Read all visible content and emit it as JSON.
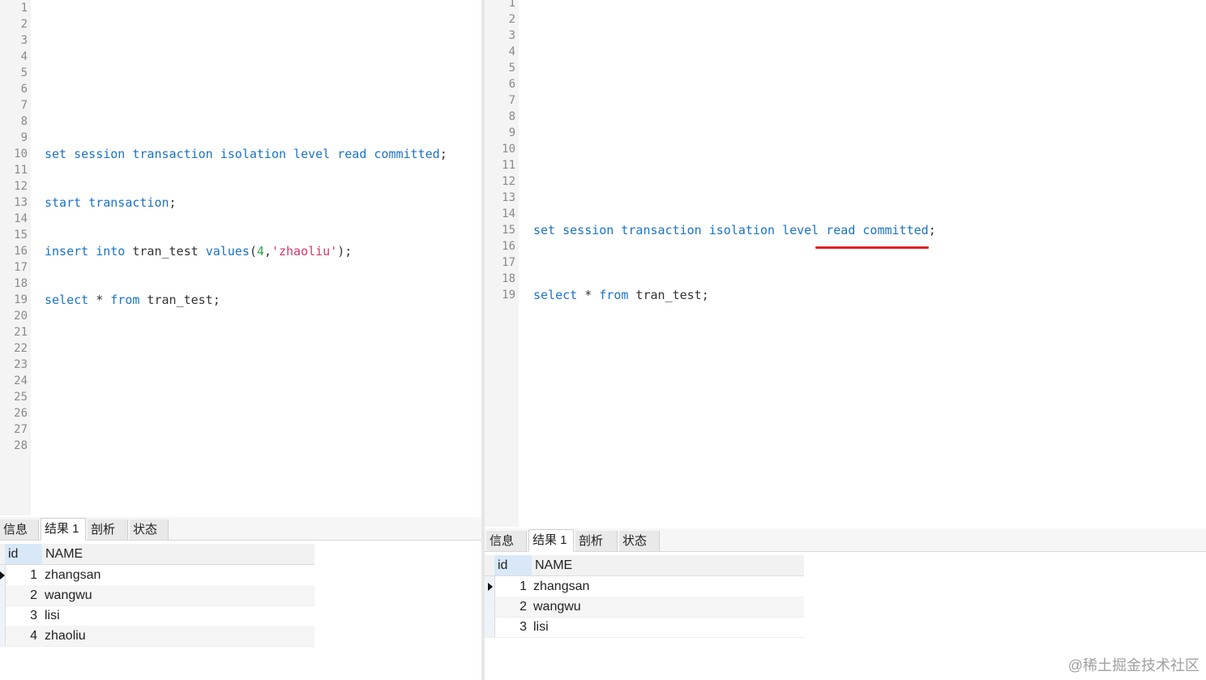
{
  "left": {
    "line_count": 28,
    "code_lines": [
      {
        "line": 10,
        "tokens": [
          {
            "t": "set",
            "c": "kw"
          },
          {
            "t": " ",
            "c": "plain"
          },
          {
            "t": "session",
            "c": "kw"
          },
          {
            "t": " ",
            "c": "plain"
          },
          {
            "t": "transaction",
            "c": "kw"
          },
          {
            "t": " ",
            "c": "plain"
          },
          {
            "t": "isolation",
            "c": "kw"
          },
          {
            "t": " ",
            "c": "plain"
          },
          {
            "t": "level",
            "c": "kw"
          },
          {
            "t": " ",
            "c": "plain"
          },
          {
            "t": "read",
            "c": "kw"
          },
          {
            "t": " ",
            "c": "plain"
          },
          {
            "t": "committed",
            "c": "kw"
          },
          {
            "t": ";",
            "c": "plain"
          }
        ]
      },
      {
        "line": 13,
        "tokens": [
          {
            "t": "start",
            "c": "kw"
          },
          {
            "t": " ",
            "c": "plain"
          },
          {
            "t": "transaction",
            "c": "kw"
          },
          {
            "t": ";",
            "c": "plain"
          }
        ]
      },
      {
        "line": 16,
        "tokens": [
          {
            "t": "insert",
            "c": "kw"
          },
          {
            "t": " ",
            "c": "plain"
          },
          {
            "t": "into",
            "c": "kw"
          },
          {
            "t": " tran_test ",
            "c": "plain"
          },
          {
            "t": "values",
            "c": "kw"
          },
          {
            "t": "(",
            "c": "plain"
          },
          {
            "t": "4",
            "c": "num"
          },
          {
            "t": ",",
            "c": "plain"
          },
          {
            "t": "'zhaoliu'",
            "c": "str"
          },
          {
            "t": ");",
            "c": "plain"
          }
        ]
      },
      {
        "line": 19,
        "tokens": [
          {
            "t": "select",
            "c": "kw"
          },
          {
            "t": " * ",
            "c": "plain"
          },
          {
            "t": "from",
            "c": "kw"
          },
          {
            "t": " tran_test;",
            "c": "plain"
          }
        ]
      }
    ],
    "tabs": [
      "信息",
      "结果 1",
      "剖析",
      "状态"
    ],
    "active_tab": 1,
    "columns": [
      "id",
      "NAME"
    ],
    "rows": [
      [
        "1",
        "zhangsan"
      ],
      [
        "2",
        "wangwu"
      ],
      [
        "3",
        "lisi"
      ],
      [
        "4",
        "zhaoliu"
      ]
    ],
    "selected_row": 0
  },
  "right": {
    "line_count": 19,
    "code_lines": [
      {
        "line": 15,
        "tokens": [
          {
            "t": "set",
            "c": "kw"
          },
          {
            "t": " ",
            "c": "plain"
          },
          {
            "t": "session",
            "c": "kw"
          },
          {
            "t": " ",
            "c": "plain"
          },
          {
            "t": "transaction",
            "c": "kw"
          },
          {
            "t": " ",
            "c": "plain"
          },
          {
            "t": "isolation",
            "c": "kw"
          },
          {
            "t": " ",
            "c": "plain"
          },
          {
            "t": "level",
            "c": "kw"
          },
          {
            "t": " ",
            "c": "plain"
          },
          {
            "t": "read",
            "c": "kw"
          },
          {
            "t": " ",
            "c": "plain"
          },
          {
            "t": "committed",
            "c": "kw"
          },
          {
            "t": ";",
            "c": "plain"
          }
        ]
      },
      {
        "line": 19,
        "tokens": [
          {
            "t": "select",
            "c": "kw"
          },
          {
            "t": " * ",
            "c": "plain"
          },
          {
            "t": "from",
            "c": "kw"
          },
          {
            "t": " tran_test;",
            "c": "plain"
          }
        ]
      }
    ],
    "tabs": [
      "信息",
      "结果 1",
      "剖析",
      "状态"
    ],
    "active_tab": 1,
    "columns": [
      "id",
      "NAME"
    ],
    "rows": [
      [
        "1",
        "zhangsan"
      ],
      [
        "2",
        "wangwu"
      ],
      [
        "3",
        "lisi"
      ]
    ],
    "selected_row": 0,
    "annotation": "red underline below 'read committed'"
  },
  "colors": {
    "keyword": "#1a73c8",
    "string": "#d6336c",
    "number": "#2aa84a",
    "annotation": "#e02020"
  },
  "watermark": "@稀土掘金技术社区"
}
